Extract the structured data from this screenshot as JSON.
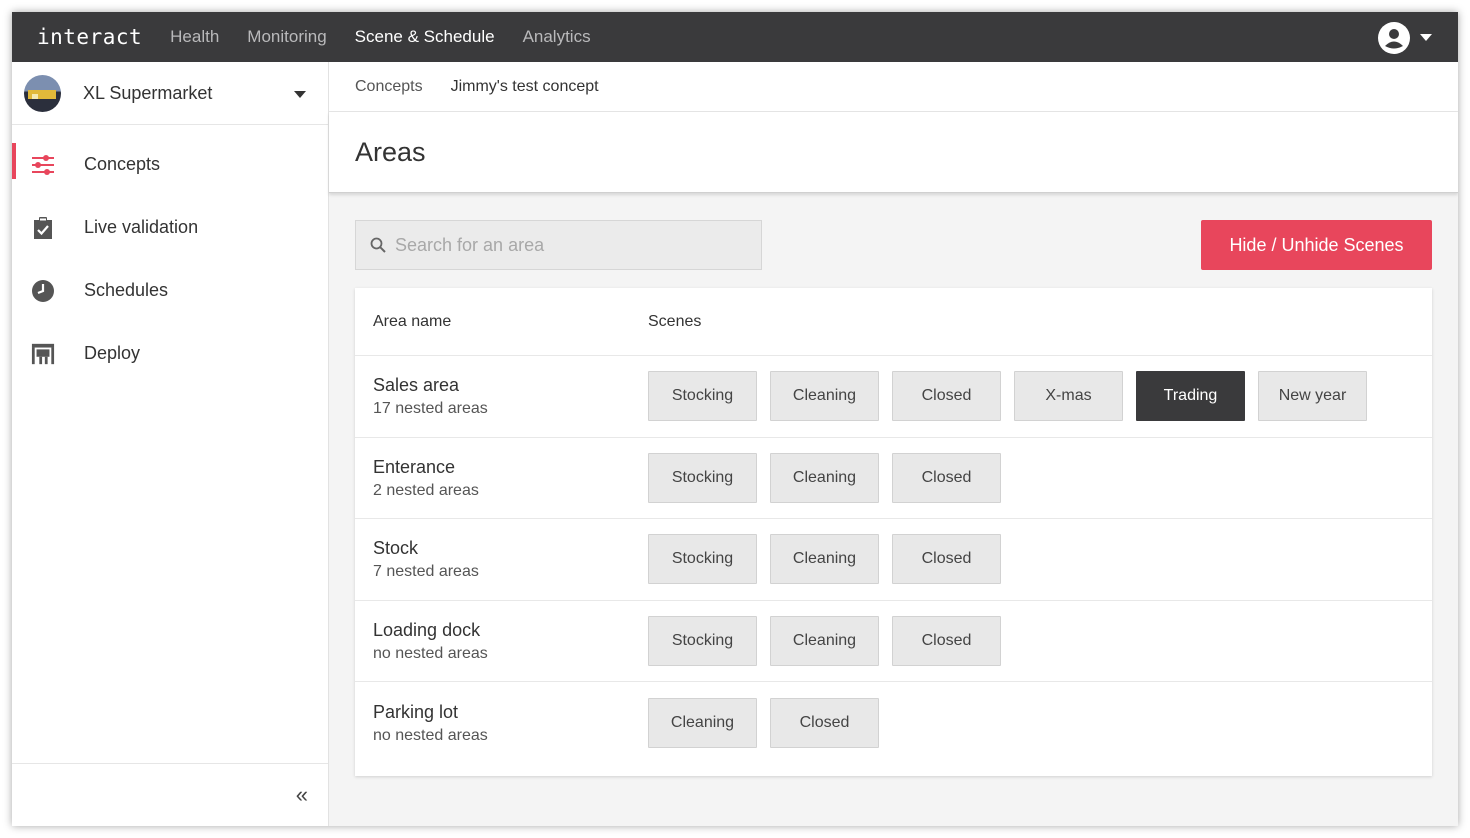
{
  "app": {
    "logo": "interact",
    "nav": [
      {
        "label": "Health",
        "active": false
      },
      {
        "label": "Monitoring",
        "active": false
      },
      {
        "label": "Scene & Schedule",
        "active": true
      },
      {
        "label": "Analytics",
        "active": false
      }
    ]
  },
  "sidebar": {
    "store_name": "XL Supermarket",
    "items": [
      {
        "label": "Concepts",
        "icon": "sliders-icon",
        "active": true
      },
      {
        "label": "Live validation",
        "icon": "clipboard-check-icon",
        "active": false
      },
      {
        "label": "Schedules",
        "icon": "clock-icon",
        "active": false
      },
      {
        "label": "Deploy",
        "icon": "deploy-icon",
        "active": false
      }
    ],
    "collapse_label": "«"
  },
  "breadcrumb": {
    "root": "Concepts",
    "current": "Jimmy's test concept"
  },
  "page": {
    "title": "Areas",
    "search_placeholder": "Search for an area",
    "hide_button": "Hide / Unhide Scenes"
  },
  "table": {
    "col_name": "Area name",
    "col_scenes": "Scenes",
    "rows": [
      {
        "name": "Sales area",
        "nested": "17 nested areas",
        "scenes": [
          "Stocking",
          "Cleaning",
          "Closed",
          "X-mas",
          "Trading",
          "New year"
        ],
        "active_scene": "Trading"
      },
      {
        "name": "Enterance",
        "nested": "2 nested areas",
        "scenes": [
          "Stocking",
          "Cleaning",
          "Closed"
        ],
        "active_scene": null
      },
      {
        "name": "Stock",
        "nested": "7 nested areas",
        "scenes": [
          "Stocking",
          "Cleaning",
          "Closed"
        ],
        "active_scene": null
      },
      {
        "name": "Loading dock",
        "nested": "no nested areas",
        "scenes": [
          "Stocking",
          "Cleaning",
          "Closed"
        ],
        "active_scene": null
      },
      {
        "name": "Parking lot",
        "nested": "no nested areas",
        "scenes": [
          "Cleaning",
          "Closed"
        ],
        "active_scene": null
      }
    ]
  },
  "colors": {
    "accent": "#e8465c",
    "topbar": "#3a3a3c",
    "active_scene": "#3a3a3c"
  }
}
